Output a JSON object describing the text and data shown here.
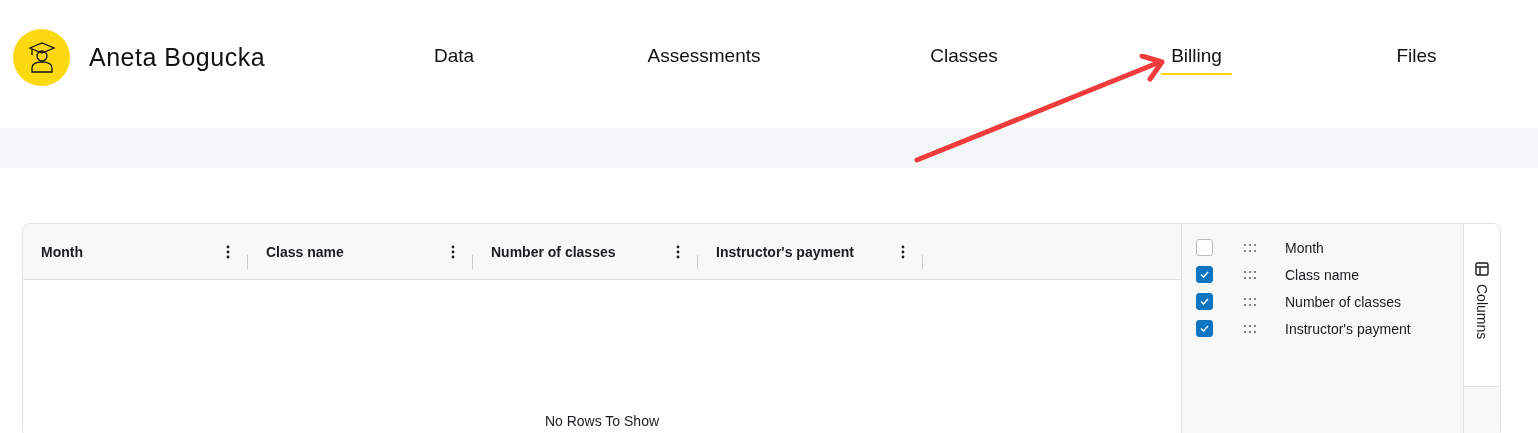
{
  "header": {
    "name": "Aneta Bogucka"
  },
  "nav": [
    {
      "label": "Data",
      "selected": false
    },
    {
      "label": "Assessments",
      "selected": false
    },
    {
      "label": "Classes",
      "selected": false
    },
    {
      "label": "Billing",
      "selected": true
    },
    {
      "label": "Files",
      "selected": false
    }
  ],
  "table": {
    "columns": [
      "Month",
      "Class name",
      "Number of classes",
      "Instructor's payment"
    ],
    "empty_message": "No Rows To Show"
  },
  "columns_panel": {
    "items": [
      {
        "label": "Month",
        "checked": false
      },
      {
        "label": "Class name",
        "checked": true
      },
      {
        "label": "Number of classes",
        "checked": true
      },
      {
        "label": "Instructor's payment",
        "checked": true
      }
    ],
    "tab": "Columns"
  }
}
